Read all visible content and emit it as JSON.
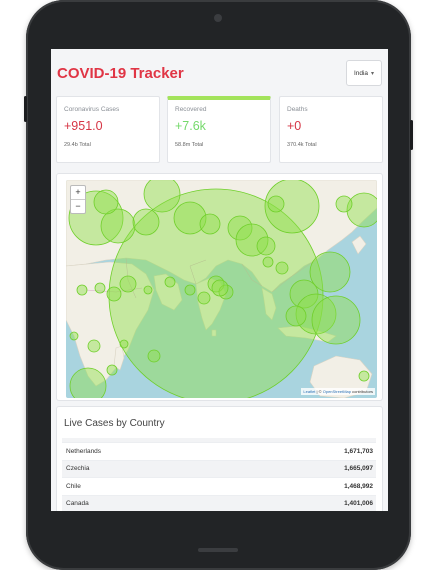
{
  "header": {
    "title": "COVID-19 Tracker",
    "country": "India"
  },
  "cards": [
    {
      "label": "Coronavirus Cases",
      "value": "+951.0",
      "total": "29.4b Total"
    },
    {
      "label": "Recovered",
      "value": "+7.6k",
      "total": "58.8m Total"
    },
    {
      "label": "Deaths",
      "value": "+0",
      "total": "370.4k Total"
    }
  ],
  "map": {
    "zoom_in": "+",
    "zoom_out": "−",
    "attribution_leaflet": "Leaflet",
    "attribution_sep": " | © ",
    "attribution_osm": "OpenStreetMap",
    "attribution_end": " contributors"
  },
  "table": {
    "title": "Live Cases by Country",
    "rows": [
      {
        "country": "Netherlands",
        "cases": "1,671,703"
      },
      {
        "country": "Czechia",
        "cases": "1,665,097"
      },
      {
        "country": "Chile",
        "cases": "1,468,992"
      },
      {
        "country": "Canada",
        "cases": "1,401,006"
      }
    ]
  },
  "colors": {
    "accent_red": "#e03545",
    "accent_green": "#a3e35b",
    "circle_fill": "#8fe04a",
    "water": "#a9d4df",
    "land": "#f2efe6"
  }
}
